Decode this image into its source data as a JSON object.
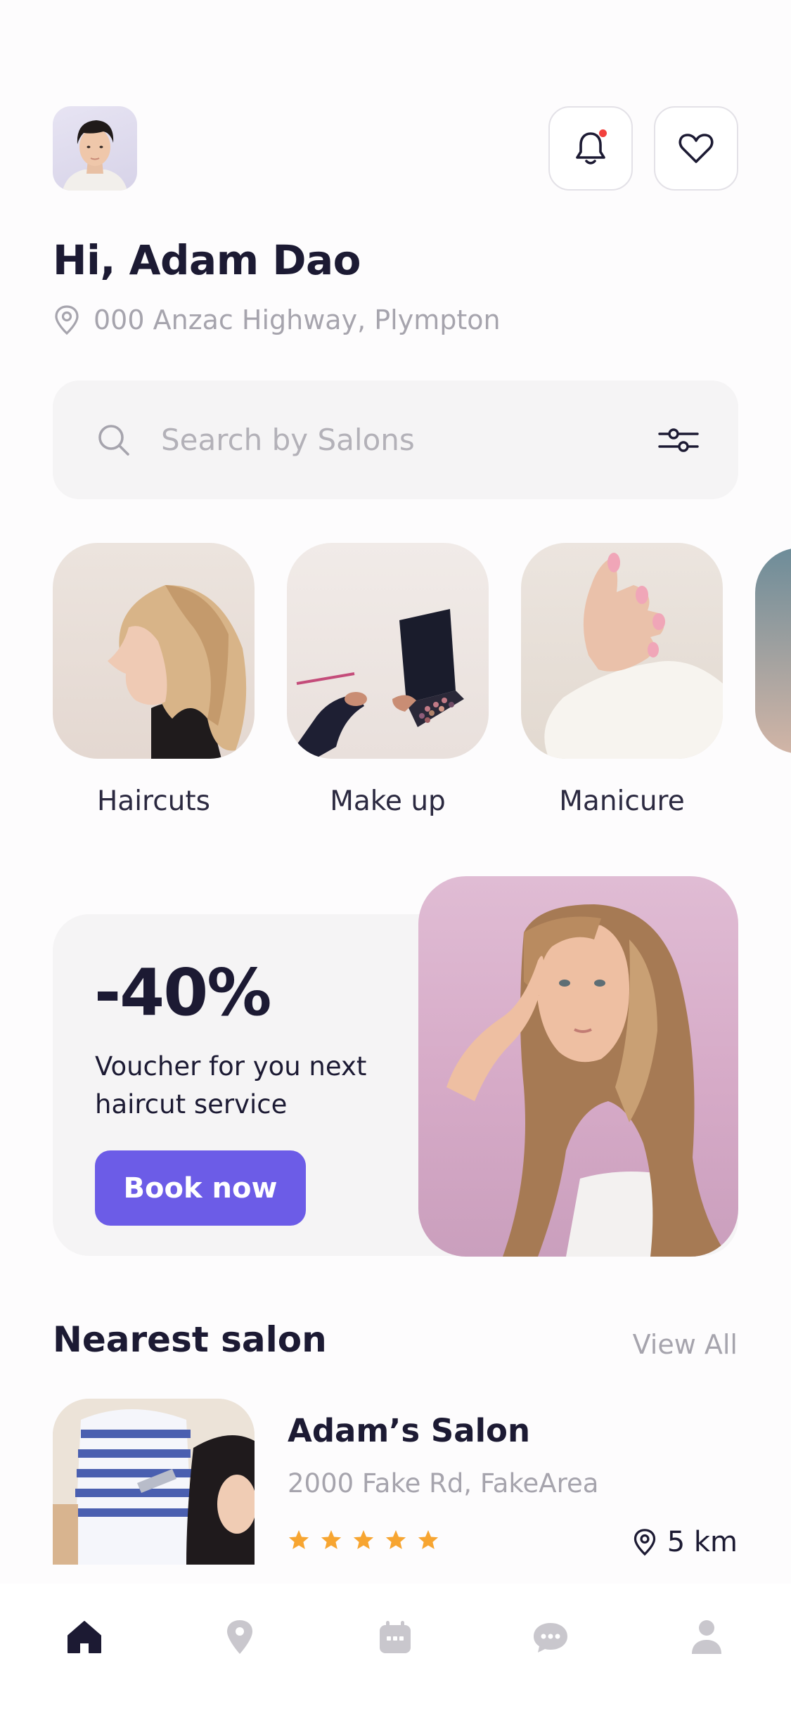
{
  "user": {
    "greeting": "Hi, Adam Dao",
    "address": "000 Anzac Highway, Plympton"
  },
  "header": {
    "notification_icon": "bell-icon",
    "favorites_icon": "heart-icon",
    "notification_dot_color": "#f2413d"
  },
  "search": {
    "placeholder": "Search by Salons",
    "value": ""
  },
  "categories": [
    {
      "label": "Haircuts"
    },
    {
      "label": "Make up"
    },
    {
      "label": "Manicure"
    }
  ],
  "promo": {
    "discount": "-40%",
    "description": "Voucher for you next haircut service",
    "button_label": "Book now"
  },
  "nearest": {
    "title": "Nearest salon",
    "view_all": "View All",
    "salon": {
      "name": "Adam’s Salon",
      "address": "2000 Fake Rd, FakeArea",
      "rating": 5,
      "distance": "5 km"
    }
  },
  "bottom_nav": [
    {
      "icon": "home-icon",
      "active": true
    },
    {
      "icon": "map-pin-icon",
      "active": false
    },
    {
      "icon": "calendar-icon",
      "active": false
    },
    {
      "icon": "chat-icon",
      "active": false
    },
    {
      "icon": "profile-icon",
      "active": false
    }
  ],
  "colors": {
    "accent": "#6c5ce7",
    "dark": "#1c1a33",
    "muted": "#a6a4ad",
    "star": "#f7a531"
  }
}
